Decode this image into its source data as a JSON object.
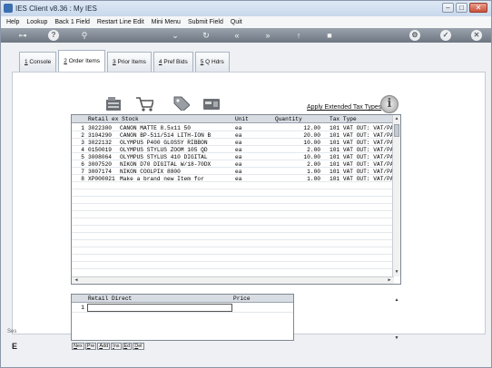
{
  "window": {
    "title": "IES Client v8.36 : My IES"
  },
  "menu": {
    "items": [
      "Help",
      "Lookup",
      "Back 1 Field",
      "Restart Line Edit",
      "Mini Menu",
      "Submit Field",
      "Quit"
    ]
  },
  "toolbar": {
    "icons": [
      "key-icon",
      "help-icon",
      "search-icon",
      "chevron-down-icon",
      "refresh-icon",
      "double-left-icon",
      "double-right-icon",
      "upload-icon",
      "stop-icon",
      "settings-icon",
      "check-icon",
      "close-icon"
    ]
  },
  "tabs": [
    {
      "num": "1",
      "label": " Console"
    },
    {
      "num": "2",
      "label": " Order Items"
    },
    {
      "num": "3",
      "label": " Prior Items"
    },
    {
      "num": "4",
      "label": " Pref Bids"
    },
    {
      "num": "5",
      "label": " Q Hdrs"
    }
  ],
  "actions": {
    "apply_tax_link": "Apply Extended Tax Types",
    "info_glyph": "i"
  },
  "items_grid": {
    "columns": [
      "Retail ex Stock",
      "Unit",
      "Quantity",
      "Tax Type"
    ],
    "rows": [
      {
        "n": "1",
        "code": "3022300",
        "desc": "CANON MATTE 8.5x11 50",
        "unit": "ea",
        "qty": "12.00",
        "tax": "101 VAT OUT: VAT/PA"
      },
      {
        "n": "2",
        "code": "3104290",
        "desc": "CANON BP-511/514 LITH-ION B",
        "unit": "ea",
        "qty": "20.00",
        "tax": "101 VAT OUT: VAT/PA"
      },
      {
        "n": "3",
        "code": "3022132",
        "desc": "OLYMPUS P400 GLOSSY RIBBON",
        "unit": "ea",
        "qty": "10.00",
        "tax": "101 VAT OUT: VAT/PA"
      },
      {
        "n": "4",
        "code": "0150019",
        "desc": "OLYMPUS STYLUS ZOOM 105 QD",
        "unit": "ea",
        "qty": "2.00",
        "tax": "101 VAT OUT: VAT/PA"
      },
      {
        "n": "5",
        "code": "3008064",
        "desc": "OLYMPUS STYLUS 410 DIGITAL",
        "unit": "ea",
        "qty": "10.00",
        "tax": "101 VAT OUT: VAT/PA"
      },
      {
        "n": "6",
        "code": "3007520",
        "desc": "NIKON D70 DIGITAL W/18-70DX",
        "unit": "ea",
        "qty": "2.00",
        "tax": "101 VAT OUT: VAT/PA"
      },
      {
        "n": "7",
        "code": "3007174",
        "desc": "NIKON COOLPIX 8800",
        "unit": "ea",
        "qty": "1.00",
        "tax": "101 VAT OUT: VAT/PA"
      },
      {
        "n": "8",
        "code": "XP000021",
        "desc": "Make a brand new Item for",
        "unit": "ea",
        "qty": "1.00",
        "tax": "101 VAT OUT: VAT/PA"
      }
    ]
  },
  "direct_grid": {
    "columns": [
      "Retail Direct",
      "Price"
    ],
    "rows": [
      {
        "n": "1",
        "desc": "",
        "price": ""
      }
    ]
  },
  "nav_buttons": [
    {
      "key": "N",
      "rest": "ex"
    },
    {
      "key": "P",
      "rest": "re"
    },
    {
      "key": "A",
      "rest": "dd"
    },
    {
      "key": "I",
      "rest": "ns"
    },
    {
      "key": "E",
      "rest": "d"
    },
    {
      "key": "D",
      "rest": "el"
    }
  ],
  "left_edge": {
    "label": "Ses",
    "letter": "E"
  }
}
